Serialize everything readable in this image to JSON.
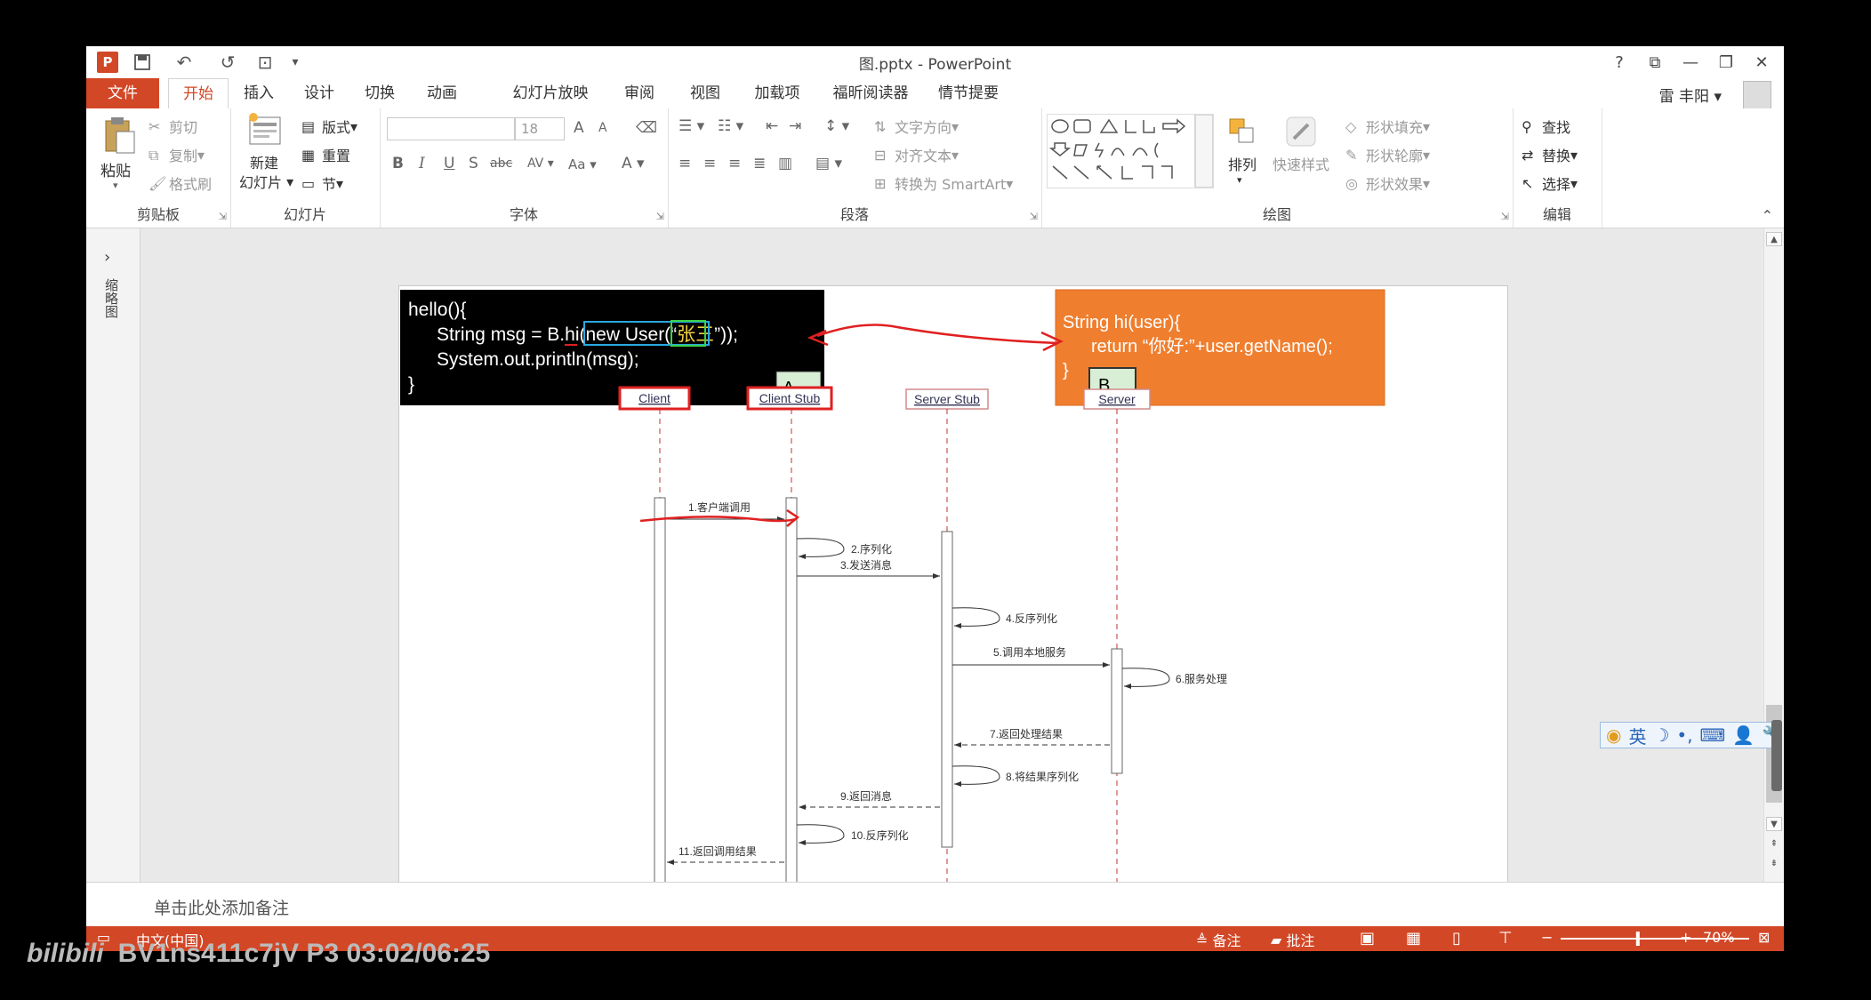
{
  "window": {
    "title": "图.pptx - PowerPoint",
    "controls": [
      "?",
      "⧉",
      "—",
      "❐",
      "✕"
    ]
  },
  "qat": {
    "app_icon": "P",
    "save": "💾",
    "undo": "↶",
    "redo": "↺",
    "present": "⊡",
    "more": "▾"
  },
  "tabs": [
    "文件",
    "开始",
    "插入",
    "设计",
    "切换",
    "动画",
    "幻灯片放映",
    "审阅",
    "视图",
    "加载项",
    "福昕阅读器",
    "情节提要"
  ],
  "active_tab": "开始",
  "user": {
    "name": "雷 丰阳"
  },
  "ribbon": {
    "clipboard": {
      "label": "剪贴板",
      "paste": "粘贴",
      "cut": "剪切",
      "copy": "复制",
      "format_painter": "格式刷"
    },
    "slides": {
      "label": "幻灯片",
      "new_slide_1": "新建",
      "new_slide_2": "幻灯片",
      "layout": "版式",
      "reset": "重置",
      "section": "节"
    },
    "font": {
      "label": "字体",
      "font_name": "",
      "font_size": "18",
      "grow": "A",
      "shrink": "A",
      "bold": "B",
      "italic": "I",
      "underline": "U",
      "shadow": "S",
      "strike": "abc",
      "spacing": "AV",
      "case": "Aa",
      "color": "A"
    },
    "paragraph": {
      "label": "段落",
      "text_direction": "文字方向",
      "align_text": "对齐文本",
      "smartart": "转换为 SmartArt"
    },
    "drawing": {
      "label": "绘图",
      "arrange": "排列",
      "quick_styles": "快速样式",
      "fill": "形状填充",
      "outline": "形状轮廓",
      "effects": "形状效果"
    },
    "editing": {
      "label": "编辑",
      "find": "查找",
      "replace": "替换",
      "select": "选择"
    }
  },
  "thumbnail_pane": {
    "label": "缩略图",
    "expand": "›"
  },
  "slide": {
    "code_a": {
      "line1": "hello(){",
      "line2a": "String msg = B.hi(",
      "line2b": "new User(“",
      "line2c": "张三",
      "line2d": "”));",
      "line3": "System.out.println(msg);",
      "line4": "}",
      "tag": "A"
    },
    "code_b": {
      "line1": "String hi(user){",
      "line2": "return “你好:”+user.getName();",
      "line3": "}",
      "tag": "B"
    },
    "lifelines": [
      "Client",
      "Client Stub",
      "Server Stub",
      "Server"
    ],
    "messages": [
      "1.客户端调用",
      "2.序列化",
      "3.发送消息",
      "4.反序列化",
      "5.调用本地服务",
      "6.服务处理",
      "7.返回处理结果",
      "8.将结果序列化",
      "9.返回消息",
      "10.反序列化",
      "11.返回调用结果"
    ]
  },
  "notes": {
    "placeholder": "单击此处添加备注"
  },
  "status": {
    "language": "中文(中国)",
    "notes_btn": "备注",
    "comments_btn": "批注",
    "zoom": "70%",
    "zoom_level": 0.7
  },
  "ime": {
    "mode": "英",
    "symbols": [
      "☽",
      "•,",
      "⌨",
      "👤",
      "🔧"
    ]
  },
  "overlay": {
    "logo": "bilibili",
    "text": "BV1ns411c7jV P3 03:02/06:25"
  },
  "colors": {
    "accent": "#d24726",
    "code_a_bg": "#000000",
    "code_b_bg": "#ef7f2f",
    "annotation": "#e02020"
  }
}
